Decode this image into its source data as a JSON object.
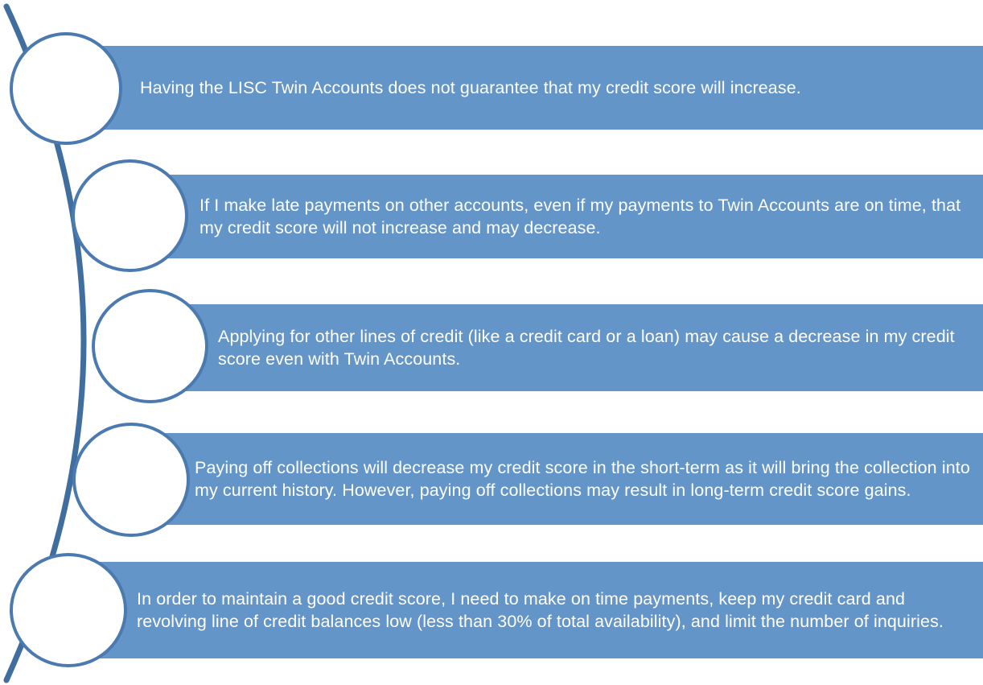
{
  "colors": {
    "bar_fill": "#6495c8",
    "circle_border": "#4b7ab0",
    "arc_line": "#3f6e9f",
    "text": "#ffffff"
  },
  "items": [
    {
      "text": "Having the LISC Twin Accounts does not guarantee that my credit score will increase."
    },
    {
      "text": "If I make late payments on other accounts, even if my payments to Twin Accounts are on time, that my credit score will not increase and may decrease."
    },
    {
      "text": "Applying for other lines of credit (like a credit card or a loan) may cause a decrease in my credit score even with Twin Accounts."
    },
    {
      "text": "Paying off collections will decrease my credit score in the short-term as it will bring the collection into my current history.  However, paying off collections may result in long-term credit score gains."
    },
    {
      "text": "In order to maintain a good credit score, I need to make on time payments, keep my credit card and revolving line of credit balances low (less than 30% of total availability), and limit the number of inquiries."
    }
  ]
}
